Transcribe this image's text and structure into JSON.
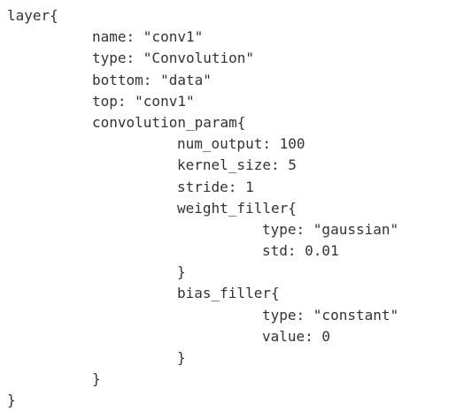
{
  "code": {
    "lines": [
      "layer{",
      "name: \"conv1\"",
      "type: \"Convolution\"",
      "bottom: \"data\"",
      "top: \"conv1\"",
      "convolution_param{",
      "num_output: 100",
      "kernel_size: 5",
      "stride: 1",
      "weight_filler{",
      "type: \"gaussian\"",
      "std: 0.01",
      "}",
      "bias_filler{",
      "type: \"constant\"",
      "value: 0",
      "}",
      "}",
      "}"
    ]
  }
}
